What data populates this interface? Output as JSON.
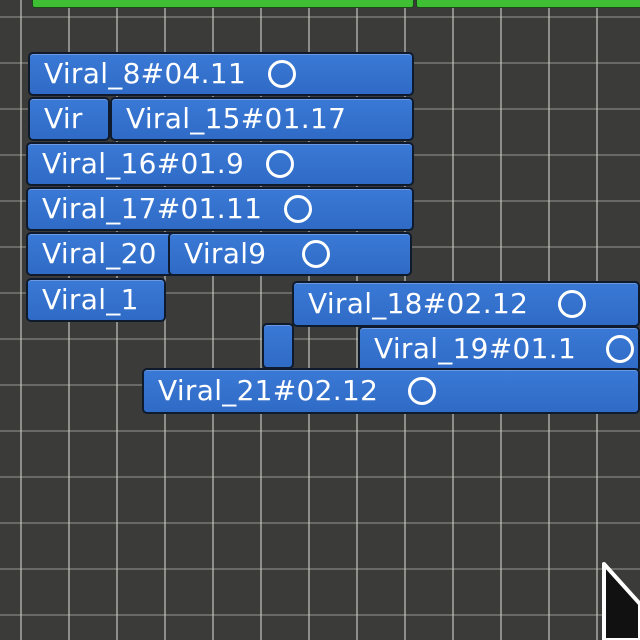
{
  "timeline": {
    "regions": [
      {
        "id": "r1",
        "label": "Viral_8#04.11"
      },
      {
        "id": "r2",
        "label": "Vir"
      },
      {
        "id": "r3",
        "label": "Viral_15#01.17"
      },
      {
        "id": "r4",
        "label": "Viral_16#01.9"
      },
      {
        "id": "r5",
        "label": "Viral_17#01.11"
      },
      {
        "id": "r6",
        "label": "Viral_20"
      },
      {
        "id": "r7",
        "label": "Viral9"
      },
      {
        "id": "r8",
        "label": "Viral_1"
      },
      {
        "id": "r9",
        "label": "Viral_18#02.12"
      },
      {
        "id": "r10",
        "label": "Viral_19#01.1"
      },
      {
        "id": "r11",
        "label": ""
      },
      {
        "id": "r12",
        "label": "Viral_21#02.12"
      }
    ]
  },
  "colors": {
    "region_fill": "#3172d0",
    "region_border": "#0f1a2c",
    "grid_background": "#3b3b39",
    "top_track": "#3fbf33"
  },
  "icons": [
    "circle-icon",
    "mouse-cursor-icon"
  ]
}
